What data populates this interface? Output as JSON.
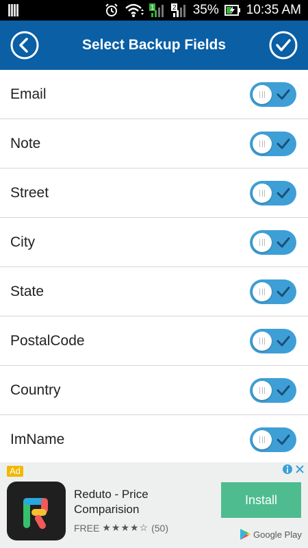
{
  "status_bar": {
    "battery_percent": "35%",
    "time": "10:35 AM",
    "icons": [
      "notification-icon",
      "alarm-icon",
      "wifi-icon",
      "signal-sim1-icon",
      "signal-sim2-icon",
      "battery-charging-icon"
    ]
  },
  "header": {
    "title": "Select Backup Fields",
    "back_icon": "back-circle-icon",
    "done_icon": "check-circle-icon",
    "background": "#0a5fa5"
  },
  "fields": [
    {
      "label": "Email",
      "enabled": true
    },
    {
      "label": "Note",
      "enabled": true
    },
    {
      "label": "Street",
      "enabled": true
    },
    {
      "label": "City",
      "enabled": true
    },
    {
      "label": "State",
      "enabled": true
    },
    {
      "label": "PostalCode",
      "enabled": true
    },
    {
      "label": "Country",
      "enabled": true
    },
    {
      "label": "ImName",
      "enabled": true
    }
  ],
  "toggle_color": "#3e9fd6",
  "ad": {
    "badge": "Ad",
    "app_name": "Reduto - Price Comparision",
    "price": "FREE",
    "rating_stars": "★★★★☆",
    "rating_count": "(50)",
    "install_label": "Install",
    "store_label": "Google Play",
    "install_color": "#4ebc8f"
  }
}
